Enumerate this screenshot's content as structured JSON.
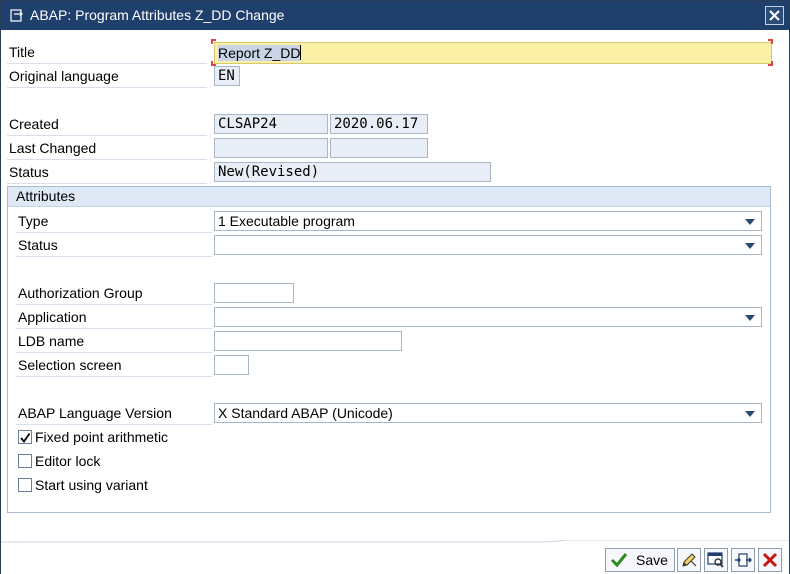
{
  "window": {
    "title": "ABAP: Program Attributes Z_DD Change",
    "icon": "edit-window-icon",
    "close_icon": "close-icon"
  },
  "header": {
    "title_label": "Title",
    "title_value": "Report Z_DD",
    "original_language_label": "Original language",
    "original_language_value": "EN",
    "created_label": "Created",
    "created_by": "CLSAP24",
    "created_date": "2020.06.17",
    "last_changed_label": "Last Changed",
    "last_changed_by": "",
    "last_changed_date": "",
    "status_label": "Status",
    "status_value": "New(Revised)"
  },
  "attributes": {
    "heading": "Attributes",
    "type_label": "Type",
    "type_value": "1 Executable program",
    "status_label": "Status",
    "status_value": "",
    "authorization_group_label": "Authorization Group",
    "authorization_group_value": "",
    "application_label": "Application",
    "application_value": "",
    "ldb_name_label": "LDB name",
    "ldb_name_value": "",
    "selection_screen_label": "Selection screen",
    "selection_screen_value": "",
    "abap_language_version_label": "ABAP Language Version",
    "abap_language_version_value": "X Standard ABAP (Unicode)",
    "checkboxes": [
      {
        "label": "Fixed point arithmetic",
        "checked": true
      },
      {
        "label": "Editor lock",
        "checked": false
      },
      {
        "label": "Start using variant",
        "checked": false
      }
    ]
  },
  "footer": {
    "save_label": "Save",
    "buttons": [
      "save-check-icon",
      "edit-pencil-icon",
      "display-object-icon",
      "transfer-icon",
      "cancel-x-icon"
    ]
  },
  "colors": {
    "titlebar": "#1f3f6c",
    "field_highlight": "#fbf1a6",
    "readonly_field": "#e7eef6",
    "group_header": "#dfe9f5",
    "cancel_red": "#cc1111",
    "save_green": "#2e8b1e"
  }
}
